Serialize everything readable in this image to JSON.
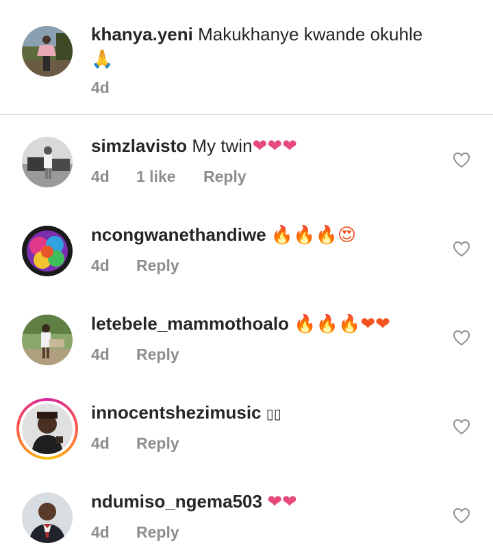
{
  "caption": {
    "username": "khanya.yeni",
    "text": "Makukhanye kwande okuhle",
    "emoji_line": "🙏",
    "time": "4d"
  },
  "comments": [
    {
      "username": "simzlavisto",
      "text": "My twin",
      "emojis": "❤❤❤",
      "time": "4d",
      "likes": "1 like",
      "reply": "Reply"
    },
    {
      "username": "ncongwanethandiwe",
      "text": "",
      "emojis": "🔥🔥🔥😍",
      "time": "4d",
      "likes": "",
      "reply": "Reply"
    },
    {
      "username": "letebele_mammothoalo",
      "text": "",
      "emojis": "🔥🔥🔥❤❤",
      "time": "4d",
      "likes": "",
      "reply": "Reply"
    },
    {
      "username": "innocentshezimusic",
      "text": "",
      "emojis": "▯▯",
      "time": "4d",
      "likes": "",
      "reply": "Reply",
      "has_story": true
    },
    {
      "username": "ndumiso_ngema503",
      "text": "",
      "emojis": "❤❤",
      "time": "4d",
      "likes": "",
      "reply": "Reply"
    }
  ],
  "icons": {
    "like": "heart-outline-icon"
  },
  "colors": {
    "text": "#262626",
    "secondary": "#8e8e8e",
    "heart": "#e6497a"
  }
}
